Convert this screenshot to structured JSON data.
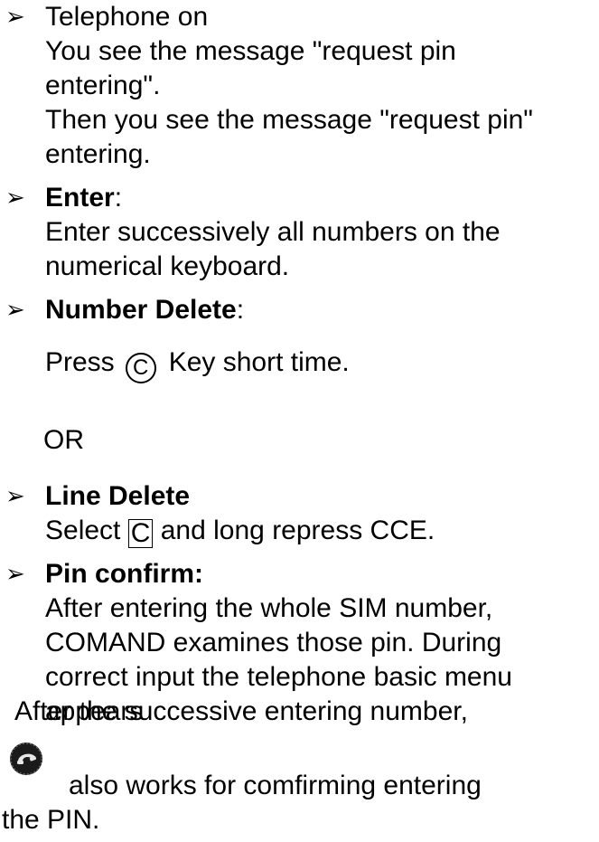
{
  "items": [
    {
      "head": "Telephone on",
      "lines": [
        "You see the message \"request pin",
        "entering\".",
        "Then you see the message \"request pin\"",
        "entering."
      ]
    },
    {
      "head_bold": "Enter",
      "head_rest": ":",
      "lines": [
        "Enter successively all numbers on the",
        "numerical keyboard."
      ]
    },
    {
      "head_bold": "Number Delete",
      "head_rest": ":",
      "press_pre": "Press",
      "key_c": "C",
      "press_post": "Key short time."
    },
    {
      "or": "OR"
    },
    {
      "head_bold": "Line Delete",
      "line_pre": "Select",
      "key_c": "C",
      "line_post": "and long repress CCE."
    },
    {
      "head_bold": "Pin confirm:",
      "lines": [
        "After entering the whole SIM number,",
        "COMAND examines those pin. During",
        "correct input the telephone basic menu",
        "appears"
      ]
    }
  ],
  "footer": {
    "line1": "After the successive entering number,",
    "line2": "also works for comfirming entering",
    "line3": "the PIN."
  },
  "icons": {
    "bullet": "arrowhead-bullet-icon",
    "phone": "phone-icon"
  }
}
